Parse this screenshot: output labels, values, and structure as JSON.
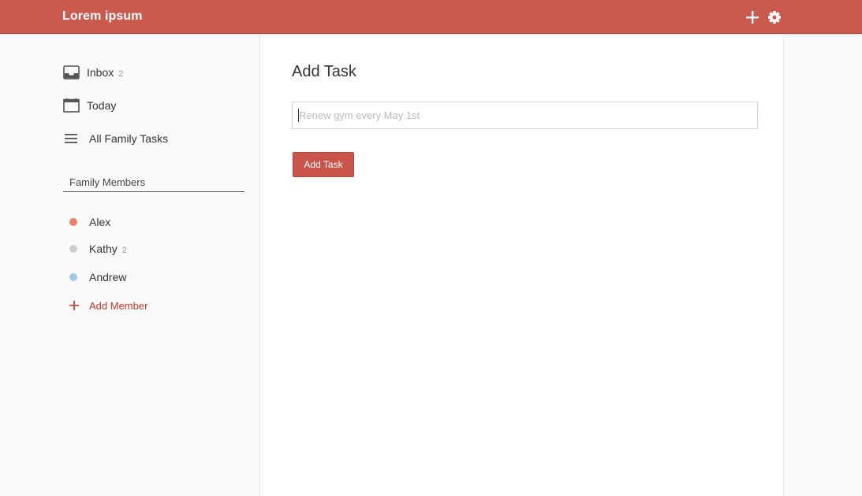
{
  "header": {
    "title": "Lorem ipsum",
    "add_icon": "plus-icon",
    "settings_icon": "gear-icon"
  },
  "sidebar": {
    "nav": [
      {
        "label": "Inbox",
        "count": "2",
        "icon": "inbox-icon"
      },
      {
        "label": "Today",
        "count": "",
        "icon": "calendar-icon"
      },
      {
        "label": "All Family Tasks",
        "count": "",
        "icon": "list-icon"
      }
    ],
    "section_title": "Family Members",
    "members": [
      {
        "name": "Alex",
        "count": "",
        "color": "#e8826b"
      },
      {
        "name": "Kathy",
        "count": "2",
        "color": "#cfcfcf"
      },
      {
        "name": "Andrew",
        "count": "",
        "color": "#a9c6e4"
      }
    ],
    "add_member_label": "Add Member"
  },
  "main": {
    "title": "Add Task",
    "input": {
      "placeholder": "Renew gym every May 1st",
      "value": ""
    },
    "submit_label": "Add Task"
  },
  "colors": {
    "brand": "#ca5a4e",
    "button": "#c9554a",
    "link": "#c0392b"
  }
}
